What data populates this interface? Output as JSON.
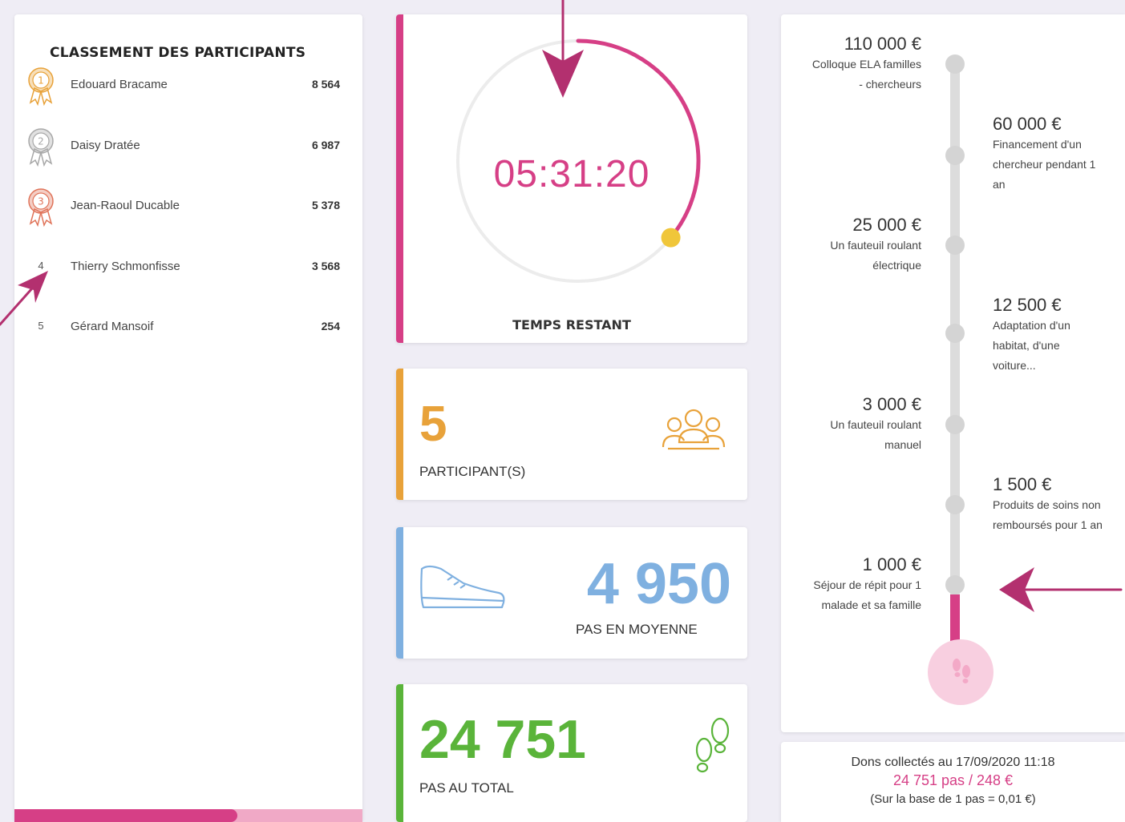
{
  "colors": {
    "accent_pink": "#d63f86",
    "participants_orange": "#e8a23a",
    "average_blue": "#7fb0e0",
    "total_green": "#5ab43a",
    "medal_gold": "#e8a23a",
    "medal_silver": "#a8a8a8",
    "medal_bronze": "#e0745a"
  },
  "ranking": {
    "title": "CLASSEMENT DES PARTICIPANTS",
    "progress": 0.64,
    "participants": [
      {
        "rank": "1",
        "name": "Edouard Bracame",
        "score": "8 564",
        "medal": "gold-medal-icon"
      },
      {
        "rank": "2",
        "name": "Daisy Dratée",
        "score": "6 987",
        "medal": "silver-medal-icon"
      },
      {
        "rank": "3",
        "name": "Jean-Raoul Ducable",
        "score": "5 378",
        "medal": "bronze-medal-icon"
      },
      {
        "rank": "4",
        "name": "Thierry Schmonfisse",
        "score": "3 568",
        "medal": null
      },
      {
        "rank": "5",
        "name": "Gérard Mansoif",
        "score": "254",
        "medal": null
      }
    ]
  },
  "timer": {
    "value": "05:31:20",
    "label": "TEMPS RESTANT",
    "remaining_fraction": 0.36
  },
  "participants": {
    "value": "5",
    "label": "PARTICIPANT(S)",
    "icon": "group-icon"
  },
  "average_steps": {
    "value": "4 950",
    "label": "PAS EN MOYENNE",
    "icon": "sneaker-icon"
  },
  "total_steps": {
    "value": "24 751",
    "label": "PAS AU TOTAL",
    "icon": "footprints-icon"
  },
  "goals": [
    {
      "amount": "110 000 €",
      "desc_lines": [
        "Colloque ELA familles",
        "- chercheurs"
      ],
      "side": "left"
    },
    {
      "amount": "60 000 €",
      "desc_lines": [
        "Financement d'un",
        "chercheur pendant 1",
        "an"
      ],
      "side": "right"
    },
    {
      "amount": "25 000 €",
      "desc_lines": [
        "Un fauteuil roulant",
        "électrique"
      ],
      "side": "left"
    },
    {
      "amount": "12 500 €",
      "desc_lines": [
        "Adaptation d'un",
        "habitat, d'une",
        "voiture..."
      ],
      "side": "right"
    },
    {
      "amount": "3 000 €",
      "desc_lines": [
        "Un fauteuil roulant",
        "manuel"
      ],
      "side": "left"
    },
    {
      "amount": "1 500 €",
      "desc_lines": [
        "Produits de soins non",
        "remboursés pour 1 an"
      ],
      "side": "right"
    },
    {
      "amount": "1 000 €",
      "desc_lines": [
        "Séjour de répit pour 1",
        "malade et sa famille"
      ],
      "side": "left"
    }
  ],
  "goals_icon": "footprints-icon",
  "donations": {
    "line1": "Dons collectés au 17/09/2020 11:18",
    "line2": "24 751 pas / 248 €",
    "line3": "(Sur la base de 1 pas = 0,01 €)"
  }
}
